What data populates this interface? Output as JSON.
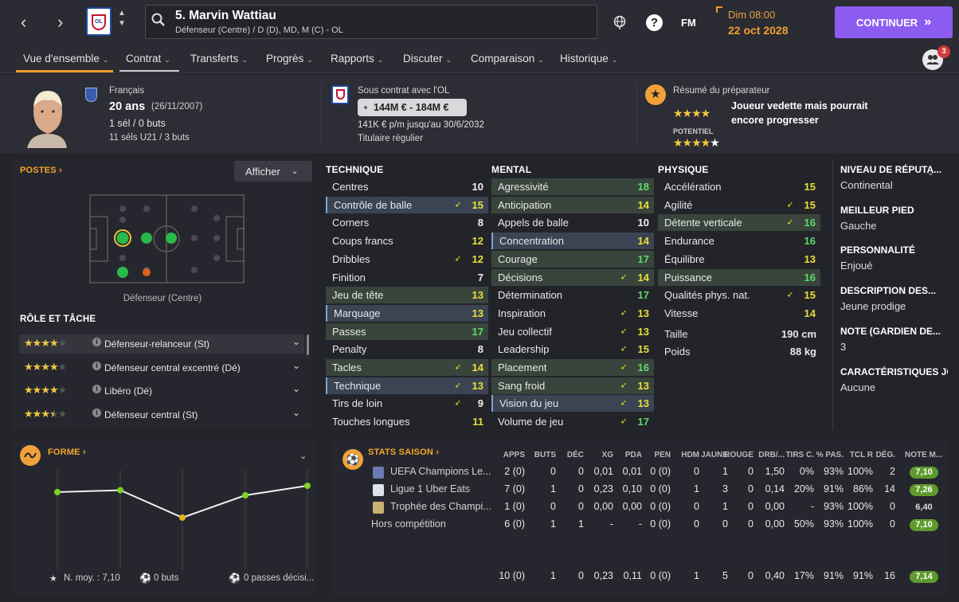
{
  "header": {
    "player_name": "5. Marvin Wattiau",
    "positions": "Défenseur (Centre) / D (D), MD, M (C) - OL",
    "fm_label": "FM",
    "date_day": "Dim 08:00",
    "date_full": "22 oct 2028",
    "continue_label": "CONTINUER",
    "notif_count": "3"
  },
  "nav": [
    "Vue d'ensemble",
    "Contrat",
    "Transferts",
    "Progrès",
    "Rapports",
    "Discuter",
    "Comparaison",
    "Historique"
  ],
  "info": {
    "nationality": "Français",
    "age": "20 ans",
    "dob": "(26/11/2007)",
    "caps": "1 sél / 0 buts",
    "u21": "11 séls U21 / 3 buts",
    "contract_with": "Sous contrat avec l'OL",
    "value": "144M € - 184M €",
    "wage": "141K € p/m jusqu'au 30/6/2032",
    "status": "Titulaire régulier",
    "scout_title": "Résumé du préparateur",
    "scout_text": "Joueur vedette mais pourrait encore progresser",
    "potential_label": "POTENTIEL",
    "current_stars": 4,
    "potential_stars": 4.5
  },
  "positions_panel": {
    "title": "POSTES",
    "show_label": "Afficher",
    "pitch_caption": "Défenseur (Centre)",
    "roles_title": "RÔLE ET TÂCHE",
    "roles": [
      {
        "stars": 4,
        "name": "Défenseur-relanceur (St)"
      },
      {
        "stars": 4,
        "name": "Défenseur central excentré (Dé)"
      },
      {
        "stars": 4,
        "name": "Libéro (Dé)"
      },
      {
        "stars": 3.5,
        "name": "Défenseur central (St)"
      }
    ]
  },
  "attributes": {
    "technique_title": "TECHNIQUE",
    "mental_title": "MENTAL",
    "physique_title": "PHYSIQUE",
    "technique": [
      {
        "name": "Centres",
        "value": "10",
        "hl": "",
        "tri": false
      },
      {
        "name": "Contrôle de balle",
        "value": "15",
        "hl": "blue",
        "tri": true
      },
      {
        "name": "Corners",
        "value": "8",
        "hl": "",
        "tri": false
      },
      {
        "name": "Coups francs",
        "value": "12",
        "hl": "",
        "tri": false
      },
      {
        "name": "Dribbles",
        "value": "12",
        "hl": "",
        "tri": true
      },
      {
        "name": "Finition",
        "value": "7",
        "hl": "",
        "tri": false
      },
      {
        "name": "Jeu de tête",
        "value": "13",
        "hl": "green",
        "tri": false
      },
      {
        "name": "Marquage",
        "value": "13",
        "hl": "blue",
        "tri": false
      },
      {
        "name": "Passes",
        "value": "17",
        "hl": "green",
        "tri": false
      },
      {
        "name": "Penalty",
        "value": "8",
        "hl": "",
        "tri": false
      },
      {
        "name": "Tacles",
        "value": "14",
        "hl": "green",
        "tri": true
      },
      {
        "name": "Technique",
        "value": "13",
        "hl": "blue",
        "tri": true
      },
      {
        "name": "Tirs de loin",
        "value": "9",
        "hl": "",
        "tri": true
      },
      {
        "name": "Touches longues",
        "value": "11",
        "hl": "",
        "tri": false
      }
    ],
    "mental": [
      {
        "name": "Agressivité",
        "value": "18",
        "hl": "green",
        "tri": false
      },
      {
        "name": "Anticipation",
        "value": "14",
        "hl": "green",
        "tri": false
      },
      {
        "name": "Appels de balle",
        "value": "10",
        "hl": "",
        "tri": false
      },
      {
        "name": "Concentration",
        "value": "14",
        "hl": "blue",
        "tri": false
      },
      {
        "name": "Courage",
        "value": "17",
        "hl": "green",
        "tri": false
      },
      {
        "name": "Décisions",
        "value": "14",
        "hl": "green",
        "tri": true
      },
      {
        "name": "Détermination",
        "value": "17",
        "hl": "",
        "tri": false
      },
      {
        "name": "Inspiration",
        "value": "13",
        "hl": "",
        "tri": true
      },
      {
        "name": "Jeu collectif",
        "value": "13",
        "hl": "",
        "tri": true
      },
      {
        "name": "Leadership",
        "value": "15",
        "hl": "",
        "tri": true
      },
      {
        "name": "Placement",
        "value": "16",
        "hl": "green",
        "tri": true
      },
      {
        "name": "Sang froid",
        "value": "13",
        "hl": "green",
        "tri": true
      },
      {
        "name": "Vision du jeu",
        "value": "13",
        "hl": "blue",
        "tri": true
      },
      {
        "name": "Volume de jeu",
        "value": "17",
        "hl": "",
        "tri": true
      }
    ],
    "physique": [
      {
        "name": "Accélération",
        "value": "15",
        "hl": "",
        "tri": false
      },
      {
        "name": "Agilité",
        "value": "15",
        "hl": "",
        "tri": true
      },
      {
        "name": "Détente verticale",
        "value": "16",
        "hl": "green",
        "tri": true
      },
      {
        "name": "Endurance",
        "value": "16",
        "hl": "",
        "tri": false
      },
      {
        "name": "Équilibre",
        "value": "13",
        "hl": "",
        "tri": false
      },
      {
        "name": "Puissance",
        "value": "16",
        "hl": "green",
        "tri": false
      },
      {
        "name": "Qualités phys. nat.",
        "value": "15",
        "hl": "",
        "tri": true
      },
      {
        "name": "Vitesse",
        "value": "14",
        "hl": "",
        "tri": false
      }
    ],
    "height_label": "Taille",
    "height": "190 cm",
    "weight_label": "Poids",
    "weight": "88 kg"
  },
  "side": [
    {
      "label": "NIVEAU DE RÉPUTA...",
      "value": "Continental"
    },
    {
      "label": "MEILLEUR PIED",
      "value": "Gauche"
    },
    {
      "label": "PERSONNALITÉ",
      "value": "Enjoué"
    },
    {
      "label": "DESCRIPTION DES...",
      "value": "Jeune prodige"
    },
    {
      "label": "NOTE (GARDIEN DE...",
      "value": "3"
    },
    {
      "label": "CARACTÉRISTIQUES JO",
      "value": "Aucune"
    }
  ],
  "form": {
    "title": "FORME",
    "avg": "N. moy. : 7,10",
    "goals": "0 buts",
    "assists": "0 passes décisi...",
    "points": [
      7.2,
      7.26,
      6.4,
      7.1,
      7.4
    ]
  },
  "season": {
    "title": "STATS SAISON",
    "headers": [
      "APPS",
      "BUTS",
      "DÉC",
      "XG",
      "PDA",
      "PEN",
      "HDM",
      "JAUNE",
      "ROUGE",
      "DRB/...",
      "TIRS C.",
      "% PAS.",
      "TCL R",
      "DÉG.",
      "NOTE M..."
    ],
    "rows": [
      {
        "comp": "UEFA Champions Le...",
        "cells": [
          "2 (0)",
          "0",
          "0",
          "0,01",
          "0,01",
          "0 (0)",
          "0",
          "1",
          "0",
          "1,50",
          "0%",
          "93%",
          "100%",
          "2"
        ],
        "note": "7,10",
        "good": true
      },
      {
        "comp": "Ligue 1 Uber Eats",
        "cells": [
          "7 (0)",
          "1",
          "0",
          "0,23",
          "0,10",
          "0 (0)",
          "1",
          "3",
          "0",
          "0,14",
          "20%",
          "91%",
          "86%",
          "14"
        ],
        "note": "7,26",
        "good": true
      },
      {
        "comp": "Trophée des Champi...",
        "cells": [
          "1 (0)",
          "0",
          "0",
          "0,00",
          "0,00",
          "0 (0)",
          "0",
          "1",
          "0",
          "0,00",
          "-",
          "93%",
          "100%",
          "0"
        ],
        "note": "6,40",
        "good": false
      },
      {
        "comp": "Hors compétition",
        "cells": [
          "6 (0)",
          "1",
          "1",
          "-",
          "-",
          "0 (0)",
          "0",
          "0",
          "0",
          "0,00",
          "50%",
          "93%",
          "100%",
          "0"
        ],
        "note": "7,10",
        "good": true
      }
    ],
    "total": {
      "cells": [
        "10 (0)",
        "1",
        "0",
        "0,23",
        "0,11",
        "0 (0)",
        "1",
        "5",
        "0",
        "0,40",
        "17%",
        "91%",
        "91%",
        "16"
      ],
      "note": "7,14"
    }
  }
}
